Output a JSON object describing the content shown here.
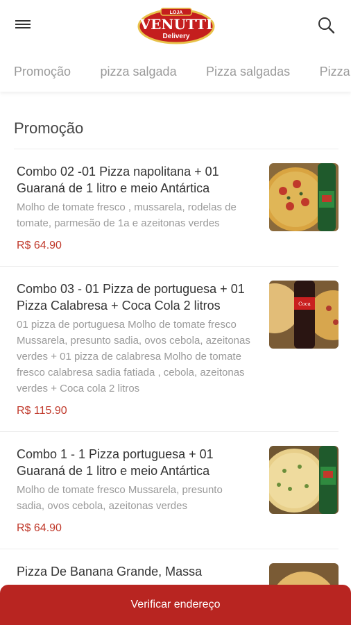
{
  "header": {
    "logo_brand": "VENUTTI",
    "logo_sub": "Delivery",
    "logo_top": "LOJA"
  },
  "categories": [
    "Promoção",
    "pizza salgada",
    "Pizza salgadas",
    "Pizza"
  ],
  "section": {
    "title": "Promoção"
  },
  "products": [
    {
      "name": "Combo 02 -01 Pizza napolitana + 01 Guaraná de 1 litro e meio Antártica",
      "description": "Molho de tomate fresco , mussarela, rodelas de tomate, parmesão de 1a e azeitonas verdes",
      "price": "R$ 64.90"
    },
    {
      "name": "Combo 03 - 01 Pizza de portuguesa + 01 Pizza Calabresa + Coca Cola 2 litros",
      "description": "01 pizza de portuguesa Molho de tomate fresco Mussarela, presunto sadia, ovos cebola, azeitonas verdes + 01 pizza de calabresa Molho de tomate fresco calabresa sadia fatiada , cebola, azeitonas verdes + Coca cola 2 litros",
      "price": "R$ 115.90"
    },
    {
      "name": "Combo 1 - 1 Pizza portuguesa + 01 Guaraná de 1 litro e meio Antártica",
      "description": "Molho de tomate fresco Mussarela, presunto sadia, ovos cebola, azeitonas verdes",
      "price": "R$ 64.90"
    },
    {
      "name": "Pizza De Banana Grande, Massa",
      "description": "",
      "price": ""
    }
  ],
  "cta": {
    "label": "Verificar endereço"
  },
  "colors": {
    "accent": "#b82521",
    "price": "#c0392b"
  }
}
